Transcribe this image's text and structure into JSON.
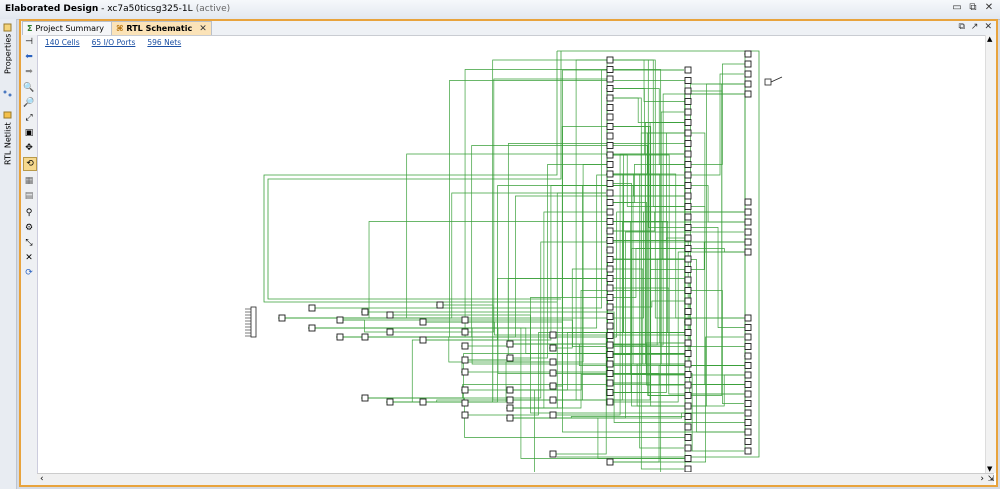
{
  "window": {
    "title_bold": "Elaborated Design",
    "title_part": " - xc7a50ticsg325-1L",
    "title_status": "(active)"
  },
  "side_tabs": [
    {
      "label": "Properties",
      "icon": "properties-icon"
    },
    {
      "label": "RTL Netlist",
      "icon": "netlist-icon"
    }
  ],
  "tabs": [
    {
      "label": "Project Summary",
      "icon": "sigma-icon",
      "active": false
    },
    {
      "label": "RTL Schematic",
      "icon": "schematic-icon",
      "active": true
    }
  ],
  "stats": {
    "cells": "140 Cells",
    "ports": "65 I/O Ports",
    "nets": "596 Nets"
  },
  "toolbar": [
    "go-to-source-icon",
    "back-icon",
    "forward-icon",
    "zoom-in-icon",
    "zoom-out-icon",
    "zoom-fit-icon",
    "zoom-area-icon",
    "auto-fit-icon",
    "toggle-icon",
    "select-area-icon",
    "grid-icon",
    "search-icon",
    "settings-icon",
    "expand-icon",
    "collapse-icon",
    "refresh-icon"
  ],
  "colors": {
    "wire": "#3aa03a",
    "accent": "#e8a33c"
  }
}
